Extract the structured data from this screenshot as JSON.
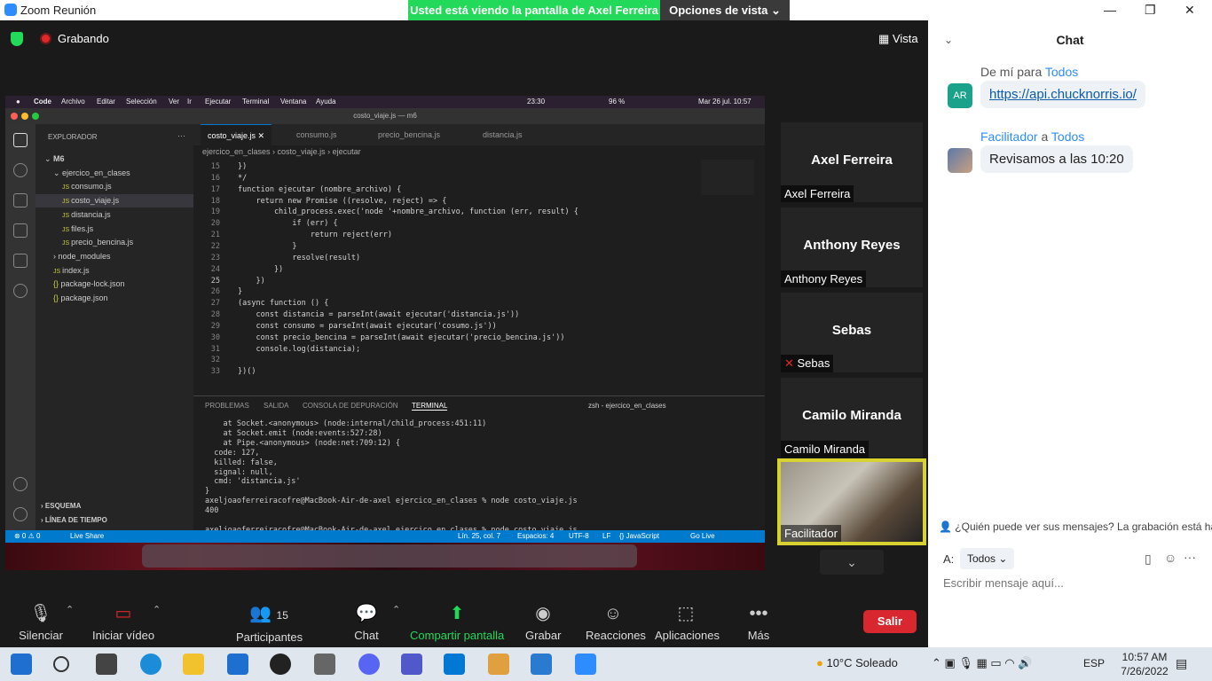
{
  "window": {
    "title": "Zoom Reunión",
    "banner": "Usted está viendo la pantalla de Axel Ferreira",
    "view_options": "Opciones de vista ⌄"
  },
  "meeting": {
    "recording": "Grabando",
    "view": "Vista"
  },
  "shared_screen": {
    "mac_menu": [
      "Code",
      "Archivo",
      "Editar",
      "Selección",
      "Ver",
      "Ir",
      "Ejecutar",
      "Terminal",
      "Ventana",
      "Ayuda"
    ],
    "mac_status": {
      "time_left": "23:30",
      "battery": "96 %",
      "date_time": "Mar 26 jul.  10:57"
    },
    "vscode_title": "costo_viaje.js — m6",
    "explorer_title": "EXPLORADOR",
    "tree": [
      {
        "label": "M6",
        "indent": 0,
        "kind": "root"
      },
      {
        "label": "ejercico_en_clases",
        "indent": 1,
        "kind": "folder"
      },
      {
        "label": "consumo.js",
        "indent": 2,
        "kind": "js"
      },
      {
        "label": "costo_viaje.js",
        "indent": 2,
        "kind": "js",
        "selected": true
      },
      {
        "label": "distancia.js",
        "indent": 2,
        "kind": "js"
      },
      {
        "label": "files.js",
        "indent": 2,
        "kind": "js"
      },
      {
        "label": "precio_bencina.js",
        "indent": 2,
        "kind": "js"
      },
      {
        "label": "node_modules",
        "indent": 1,
        "kind": "folder"
      },
      {
        "label": "index.js",
        "indent": 1,
        "kind": "js"
      },
      {
        "label": "package-lock.json",
        "indent": 1,
        "kind": "json"
      },
      {
        "label": "package.json",
        "indent": 1,
        "kind": "json"
      }
    ],
    "outline_sections": [
      "ESQUEMA",
      "LÍNEA DE TIEMPO"
    ],
    "tabs": [
      "costo_viaje.js",
      "consumo.js",
      "precio_bencina.js",
      "distancia.js"
    ],
    "breadcrumb": [
      "ejercico_en_clases",
      "costo_viaje.js",
      "ejecutar"
    ],
    "code": [
      {
        "n": "15",
        "t": "})"
      },
      {
        "n": "16",
        "t": "*/"
      },
      {
        "n": "17",
        "t": "function ejecutar (nombre_archivo) {"
      },
      {
        "n": "18",
        "t": "    return new Promise ((resolve, reject) => {"
      },
      {
        "n": "19",
        "t": "        child_process.exec('node '+nombre_archivo, function (err, result) {"
      },
      {
        "n": "20",
        "t": "            if (err) {"
      },
      {
        "n": "21",
        "t": "                return reject(err)"
      },
      {
        "n": "22",
        "t": "            }"
      },
      {
        "n": "23",
        "t": "            resolve(result)"
      },
      {
        "n": "24",
        "t": "        })"
      },
      {
        "n": "25",
        "t": "    })"
      },
      {
        "n": "26",
        "t": "}"
      },
      {
        "n": "27",
        "t": "(async function () {"
      },
      {
        "n": "28",
        "t": "    const distancia = parseInt(await ejecutar('distancia.js'))"
      },
      {
        "n": "29",
        "t": "    const consumo = parseInt(await ejecutar('cosumo.js'))"
      },
      {
        "n": "30",
        "t": "    const precio_bencina = parseInt(await ejecutar('precio_bencina.js'))"
      },
      {
        "n": "31",
        "t": "    console.log(distancia);"
      },
      {
        "n": "32",
        "t": ""
      },
      {
        "n": "33",
        "t": "})()"
      }
    ],
    "panel_tabs": [
      "PROBLEMAS",
      "SALIDA",
      "CONSOLA DE DEPURACIÓN",
      "TERMINAL"
    ],
    "terminal_name": "zsh - ejercico_en_clases",
    "terminal": [
      "    at Socket.<anonymous> (node:internal/child_process:451:11)",
      "    at Socket.emit (node:events:527:28)",
      "    at Pipe.<anonymous> (node:net:709:12) {",
      "  code: 127,",
      "  killed: false,",
      "  signal: null,",
      "  cmd: 'distancia.js'",
      "}",
      "axeljoaoferreiracofre@MacBook-Air-de-axel ejercico_en_clases % node costo_viaje.js",
      "400",
      "",
      "axeljoaoferreiracofre@MacBook-Air-de-axel ejercico_en_clases % node costo_viaje.js"
    ],
    "status": {
      "problems": "⊗ 0 ⚠ 0",
      "live_share": "Live Share",
      "position": "Lín. 25, col. 7",
      "spaces": "Espacios: 4",
      "encoding": "UTF-8",
      "eol": "LF",
      "language": "{} JavaScript",
      "go_live": "Go Live"
    }
  },
  "participants": [
    {
      "name": "Axel Ferreira",
      "muted": false
    },
    {
      "name": "Anthony Reyes",
      "muted": false
    },
    {
      "name": "Sebas",
      "muted": true
    },
    {
      "name": "Camilo Miranda",
      "muted": false
    }
  ],
  "self_view": {
    "name": "Facilitador"
  },
  "controls": {
    "mute": "Silenciar",
    "video": "Iniciar vídeo",
    "participants": "Participantes",
    "participants_count": "15",
    "chat": "Chat",
    "share": "Compartir pantalla",
    "record": "Grabar",
    "reactions": "Reacciones",
    "apps": "Aplicaciones",
    "more": "Más",
    "leave": "Salir"
  },
  "chat": {
    "title": "Chat",
    "messages": [
      {
        "from": "De mí",
        "sep": " para ",
        "to": "Todos",
        "avatar": "AR",
        "text": "https://api.chucknorris.io/",
        "is_link": true
      },
      {
        "from": "Facilitador",
        "sep": " a ",
        "to": "Todos",
        "avatar": "",
        "text": "Revisamos a las 10:20",
        "is_link": false
      }
    ],
    "notice": "¿Quién puede ver sus mensajes? La grabación está habilitada",
    "to_label": "A:",
    "to_value": "Todos",
    "input_placeholder": "Escribir mensaje aquí..."
  },
  "taskbar": {
    "weather": "10°C  Soleado",
    "lang": "ESP",
    "time": "10:57 AM",
    "date": "7/26/2022"
  },
  "colors": {
    "accent": "#2d8cff",
    "banner_green": "#23d959",
    "leave_red": "#d8272e",
    "vscode_blue": "#007acc"
  }
}
